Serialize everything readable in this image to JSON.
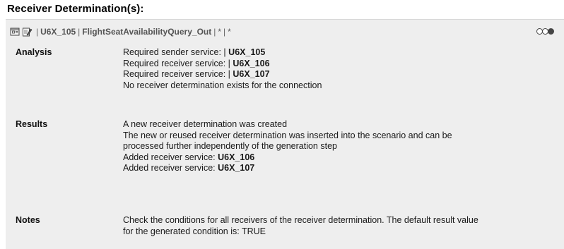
{
  "title": "Receiver Determination(s):",
  "object_header": {
    "icons": [
      "folder-icon",
      "edit-icon"
    ],
    "sender_service": "U6X_105",
    "interface": "FlightSeatAvailabilityQuery_Out",
    "party": "*",
    "receiver": "*",
    "separator": "|",
    "status_circles": [
      "empty",
      "empty",
      "filled"
    ]
  },
  "sections": {
    "analysis": {
      "label": "Analysis",
      "lines": [
        {
          "text": "Required sender service: |",
          "value": "U6X_105"
        },
        {
          "text": "Required receiver service: |",
          "value": "U6X_106"
        },
        {
          "text": "Required receiver service: |",
          "value": "U6X_107"
        },
        {
          "text": "No receiver determination exists for the connection",
          "value": ""
        }
      ]
    },
    "results": {
      "label": "Results",
      "lines": [
        {
          "text": "A new receiver determination was created",
          "value": ""
        },
        {
          "text": "The new or reused receiver determination was inserted into the scenario and can be",
          "value": ""
        },
        {
          "text": "processed further independently of the generation step",
          "value": ""
        },
        {
          "text": "Added receiver service: ",
          "value": "U6X_106"
        },
        {
          "text": "Added receiver service: ",
          "value": "U6X_107"
        }
      ]
    },
    "notes": {
      "label": "Notes",
      "lines": [
        {
          "text": "Check the conditions for all receivers of the receiver determination. The default result value",
          "value": ""
        },
        {
          "text": "for the generated condition is: TRUE",
          "value": ""
        }
      ]
    }
  }
}
